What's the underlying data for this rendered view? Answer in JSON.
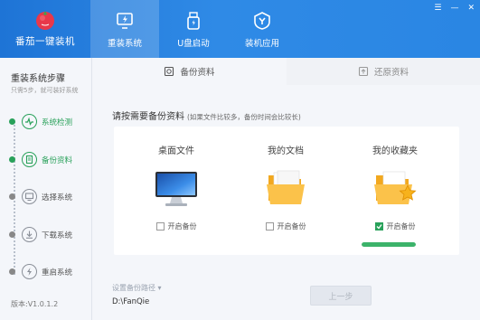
{
  "app": {
    "name": "番茄一键装机"
  },
  "nav": [
    {
      "label": "重装系统",
      "icon": "lightning-monitor-icon",
      "active": true
    },
    {
      "label": "U盘启动",
      "icon": "usb-drive-icon",
      "active": false
    },
    {
      "label": "装机应用",
      "icon": "app-shield-icon",
      "active": false
    }
  ],
  "window_controls": {
    "menu": "☰",
    "minimize": "—",
    "close": "✕"
  },
  "sidebar": {
    "title": "重装系统步骤",
    "subtitle": "只需5步，就可装好系统",
    "steps": [
      {
        "label": "系统检测",
        "icon": "pulse-icon",
        "active": true
      },
      {
        "label": "备份资料",
        "icon": "document-icon",
        "active": true
      },
      {
        "label": "选择系统",
        "icon": "monitor-icon",
        "active": false
      },
      {
        "label": "下载系统",
        "icon": "download-icon",
        "active": false
      },
      {
        "label": "重启系统",
        "icon": "lightning-icon",
        "active": false
      }
    ],
    "version": "版本:V1.0.1.2"
  },
  "tabs": [
    {
      "label": "备份资料",
      "active": true
    },
    {
      "label": "还原资料",
      "active": false
    }
  ],
  "main": {
    "prompt": "请按需要备份资料",
    "prompt_note": "(如果文件比较多，备份时间会比较长)",
    "cards": [
      {
        "title": "桌面文件",
        "checkbox_label": "开启备份",
        "checked": false,
        "icon": "desktop-computer-icon"
      },
      {
        "title": "我的文档",
        "checkbox_label": "开启备份",
        "checked": false,
        "icon": "documents-folder-icon"
      },
      {
        "title": "我的收藏夹",
        "checkbox_label": "开启备份",
        "checked": true,
        "icon": "favorites-folder-icon",
        "progress": 1.0
      }
    ],
    "path_label": "设置备份路径",
    "path_value": "D:\\FanQie",
    "prev_button": "上一步"
  },
  "colors": {
    "header": "#2a86e3",
    "accent_green": "#29a15a",
    "progress_green": "#3cb36a"
  }
}
